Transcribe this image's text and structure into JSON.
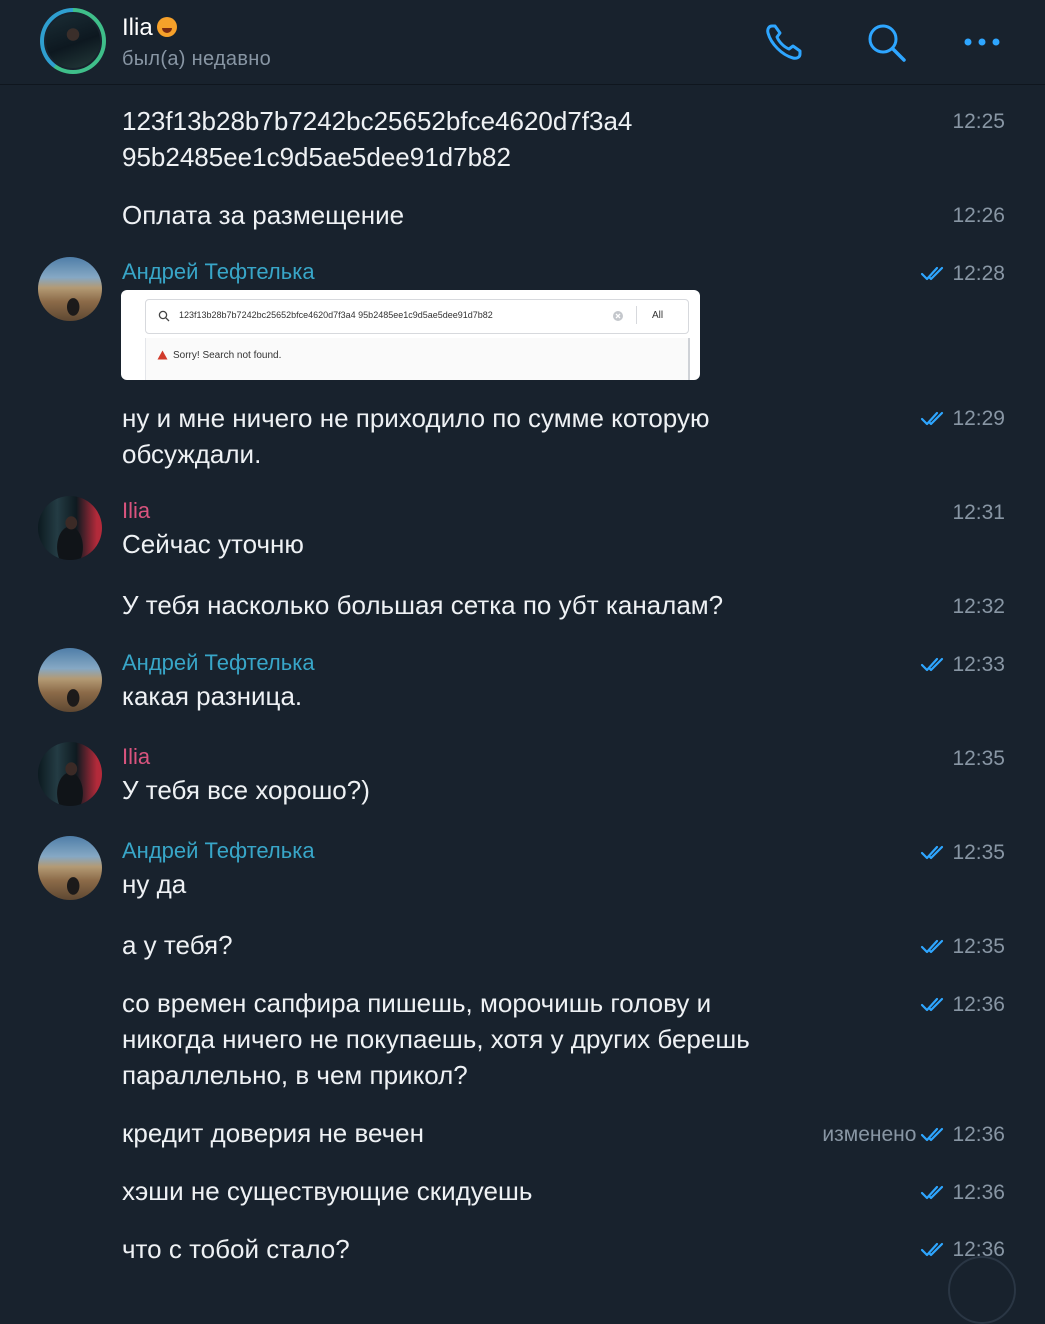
{
  "header": {
    "name": "Ilia",
    "status": "был(а) недавно",
    "icons": [
      "phone-icon",
      "search-icon",
      "more-icon"
    ]
  },
  "colors": {
    "background": "#18222d",
    "accent_blue": "#2ea6ff",
    "sender_andrey": "#38a6c8",
    "sender_ilia": "#d9547e",
    "meta_gray": "#8896a4"
  },
  "messages": [
    {
      "text": "123f13b28b7b7242bc25652bfce4620d7f3a4\n95b2485ee1c9d5ae5dee91d7b82",
      "time": "12:25"
    },
    {
      "text": "Оплата за размещение",
      "time": "12:26"
    },
    {
      "sender": "Андрей Тефтелька",
      "time": "12:28",
      "read": true,
      "image": {
        "query": "123f13b28b7b7242bc25652bfce4620d7f3a4 95b2485ee1c9d5ae5dee91d7b82",
        "filter": "All",
        "error": "Sorry! Search not found."
      }
    },
    {
      "text": "ну и мне ничего не приходило по сумме которую\nобсуждали.",
      "time": "12:29",
      "read": true
    },
    {
      "sender": "Ilia",
      "text": "Сейчас уточню",
      "time": "12:31"
    },
    {
      "text": "У тебя насколько большая сетка по убт каналам?",
      "time": "12:32"
    },
    {
      "sender": "Андрей Тефтелька",
      "text": "какая разница.",
      "time": "12:33",
      "read": true
    },
    {
      "sender": "Ilia",
      "text": "У тебя все хорошо?)",
      "time": "12:35"
    },
    {
      "sender": "Андрей Тефтелька",
      "text": "ну да",
      "time": "12:35",
      "read": true
    },
    {
      "text": "а у тебя?",
      "time": "12:35",
      "read": true
    },
    {
      "text": "со времен сапфира пишешь, морочишь голову и\nникогда ничего не покупаешь, хотя у других берешь\nпараллельно, в чем прикол?",
      "time": "12:36",
      "read": true
    },
    {
      "text": "кредит доверия не вечен",
      "time": "12:36",
      "read": true,
      "edited": "изменено"
    },
    {
      "text": "хэши не существующие скидуешь",
      "time": "12:36",
      "read": true
    },
    {
      "text": "что с тобой стало?",
      "time": "12:36",
      "read": true
    }
  ]
}
